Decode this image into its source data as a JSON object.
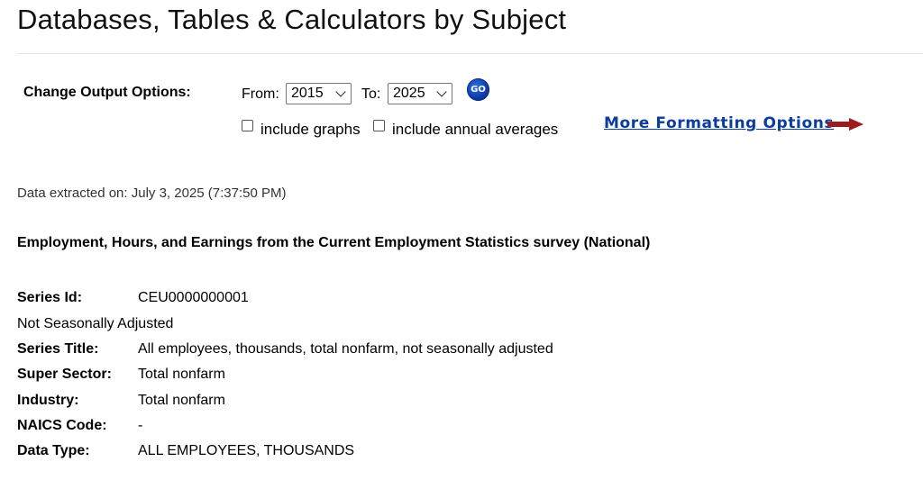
{
  "page_title": "Databases, Tables & Calculators by Subject",
  "output_options": {
    "label": "Change Output Options:",
    "from_label": "From:",
    "from_value": "2015",
    "to_label": "To:",
    "to_value": "2025",
    "go_label": "GO",
    "include_graphs_label": "include graphs",
    "include_graphs_checked": false,
    "include_annual_label": "include annual averages",
    "include_annual_checked": false,
    "more_formatting_label": "More Formatting Options",
    "arrow_icon": "right-arrow-icon",
    "arrow_color": "#9b1c1c",
    "link_color": "#0b3c9e"
  },
  "extracted_text": "Data extracted on: July 3, 2025 (7:37:50 PM)",
  "survey_title": "Employment, Hours, and Earnings from the Current Employment Statistics survey (National)",
  "series": {
    "series_id_label": "Series Id:",
    "series_id_value": "CEU0000000001",
    "adjustment": "Not Seasonally Adjusted",
    "series_title_label": "Series Title:",
    "series_title_value": "All employees, thousands, total nonfarm, not seasonally adjusted",
    "super_sector_label": "Super Sector:",
    "super_sector_value": "Total nonfarm",
    "industry_label": "Industry:",
    "industry_value": "Total nonfarm",
    "naics_label": "NAICS Code:",
    "naics_value": "-",
    "data_type_label": "Data Type:",
    "data_type_value": "ALL EMPLOYEES, THOUSANDS"
  }
}
